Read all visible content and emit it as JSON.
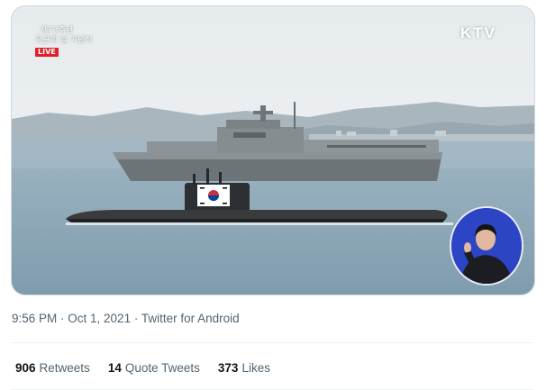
{
  "media": {
    "overlay_line1": "제73주년",
    "overlay_line2": "국군의 날 기념식",
    "live_label": "LIVE",
    "channel_logo": "KTV",
    "flag_icon": "south-korea-flag-icon",
    "colors": {
      "sky": "#e9edf0",
      "sea": "#86a3b5",
      "live": "#e0202a",
      "signer_bg": "#2a3fbf"
    }
  },
  "tweet_meta": {
    "time": "9:56 PM",
    "sep1": " · ",
    "date": "Oct 1, 2021",
    "sep2": " · ",
    "source": "Twitter for Android"
  },
  "stats": {
    "retweets_count": "906",
    "retweets_label": "Retweets",
    "quote_count": "14",
    "quote_label": "Quote Tweets",
    "likes_count": "373",
    "likes_label": "Likes"
  }
}
